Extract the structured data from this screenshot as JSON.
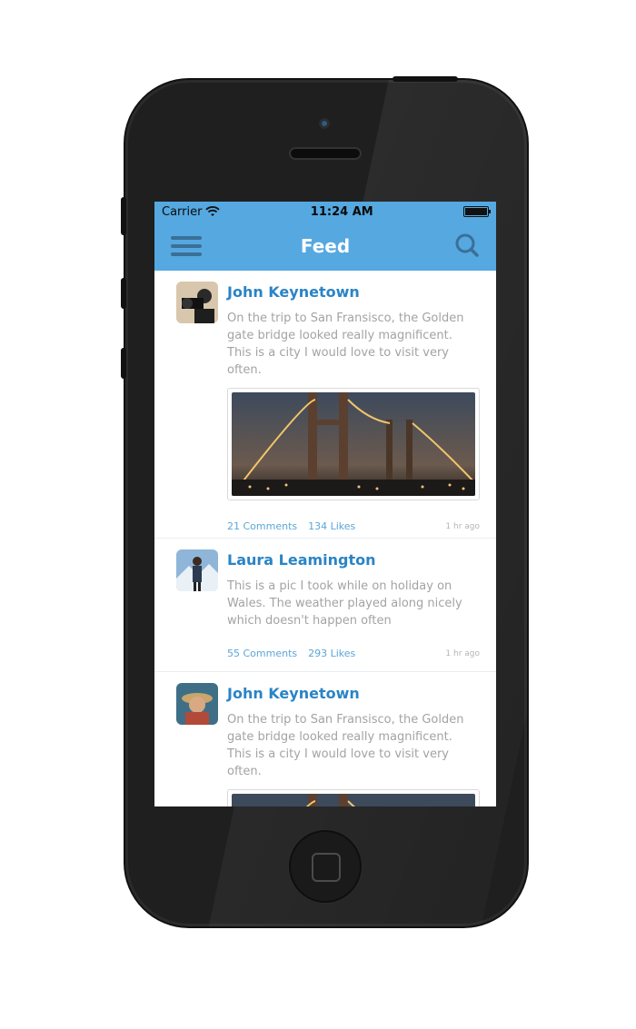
{
  "status_bar": {
    "carrier": "Carrier",
    "time": "11:24 AM"
  },
  "navbar": {
    "title": "Feed",
    "menu_icon": "hamburger-menu-icon",
    "search_icon": "search-icon"
  },
  "posts": [
    {
      "author": "John Keynetown",
      "text": "On the trip to San Fransisco, the Golden gate bridge looked really magnificent. This is a city I would love to visit very often.",
      "comments": "21 Comments",
      "likes": "134 Likes",
      "time": "1 hr ago"
    },
    {
      "author": "Laura Leamington",
      "text": "This is a pic I took while on holiday on Wales. The weather played along nicely which doesn't happen often",
      "comments": "55 Comments",
      "likes": "293 Likes",
      "time": "1 hr ago"
    },
    {
      "author": "John Keynetown",
      "text": "On the trip to San Fransisco, the Golden gate bridge looked really magnificent. This is a city I would love to visit very often."
    }
  ],
  "colors": {
    "accent": "#55a8e0",
    "author": "#2a84c6",
    "link": "#5aa6d8"
  }
}
